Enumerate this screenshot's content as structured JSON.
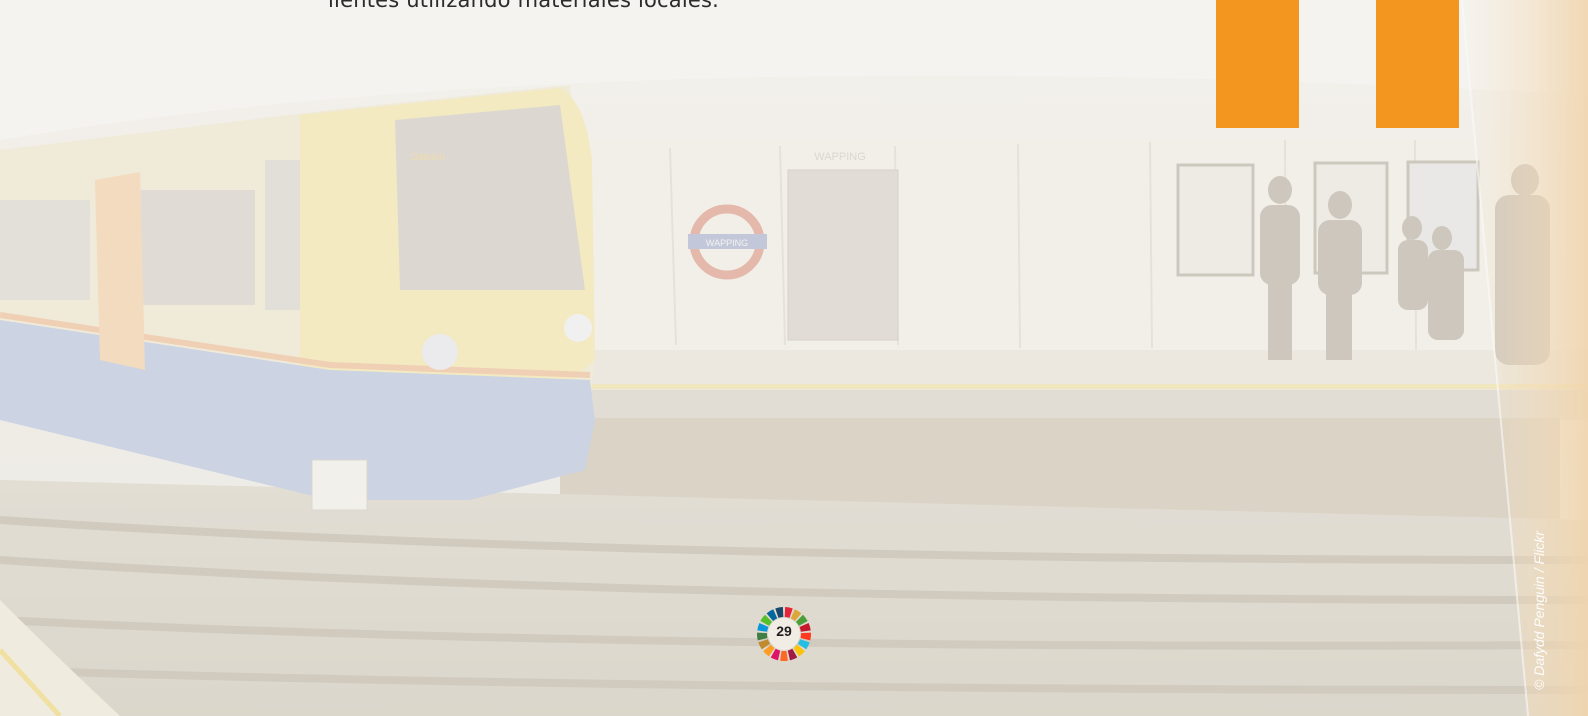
{
  "body_text": "lientes utilizando materiales locales.",
  "photo_credit": "© Dafydd Penguin / Flickr",
  "page_number": "29",
  "colors": {
    "accent_orange": "#f3961f",
    "page_background": "#ece7dd"
  },
  "photo_signs": {
    "station_roundel": "WAPPING",
    "wall_sign": "WAPPING",
    "train_destination": "Dalston"
  },
  "sdg_wheel_colors": [
    "#e5243b",
    "#dda63a",
    "#4c9f38",
    "#c5192d",
    "#ff3a21",
    "#26bde2",
    "#fcc30b",
    "#a21942",
    "#fd6925",
    "#dd1367",
    "#fd9d24",
    "#bf8b2e",
    "#3f7e44",
    "#0a97d9",
    "#56c02b",
    "#00689d",
    "#19486a"
  ]
}
